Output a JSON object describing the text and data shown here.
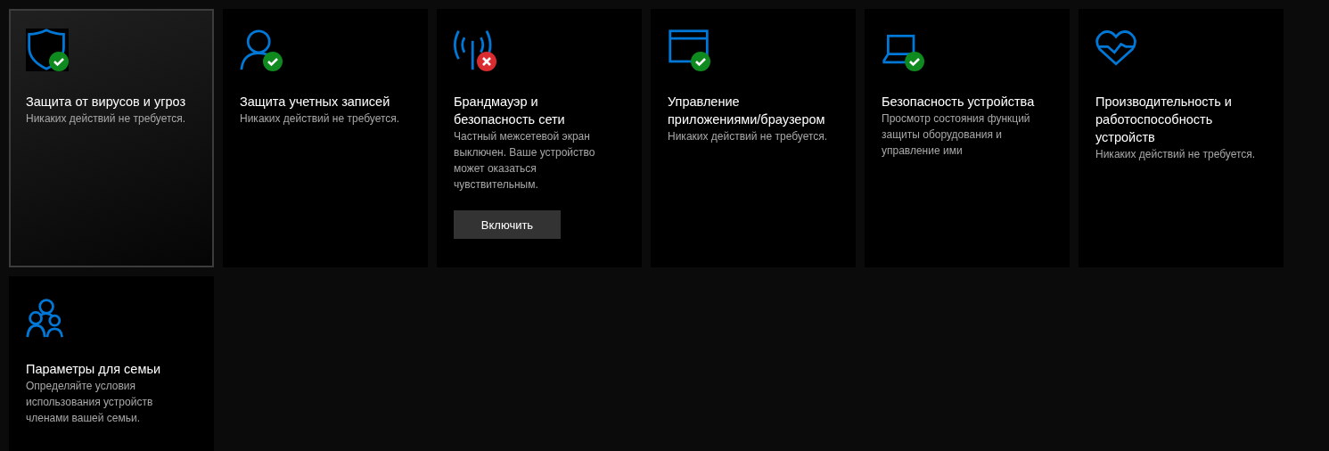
{
  "tiles": [
    {
      "kind": "ok",
      "selected": true,
      "title": "Защита от вирусов и угроз",
      "description": "Никаких действий не требуется."
    },
    {
      "kind": "ok",
      "selected": false,
      "title": "Защита учетных записей",
      "description": "Никаких действий не требуется."
    },
    {
      "kind": "alert",
      "selected": false,
      "title": "Брандмауэр и безопасность сети",
      "description": "Частный межсетевой экран выключен. Ваше устройство может оказаться чувствительным.",
      "button": "Включить"
    },
    {
      "kind": "ok",
      "selected": false,
      "title": "Управление приложениями/браузером",
      "description": "Никаких действий не требуется."
    },
    {
      "kind": "ok",
      "selected": false,
      "title": "Безопасность устройства",
      "description": "Просмотр состояния функций защиты оборудования и управление ими"
    },
    {
      "kind": "plain",
      "selected": false,
      "title": "Производительность и работоспособность устройств",
      "description": "Никаких действий не требуется."
    },
    {
      "kind": "plain",
      "selected": false,
      "title": "Параметры для семьи",
      "description": "Определяйте условия использования устройств членами вашей семьи."
    }
  ]
}
